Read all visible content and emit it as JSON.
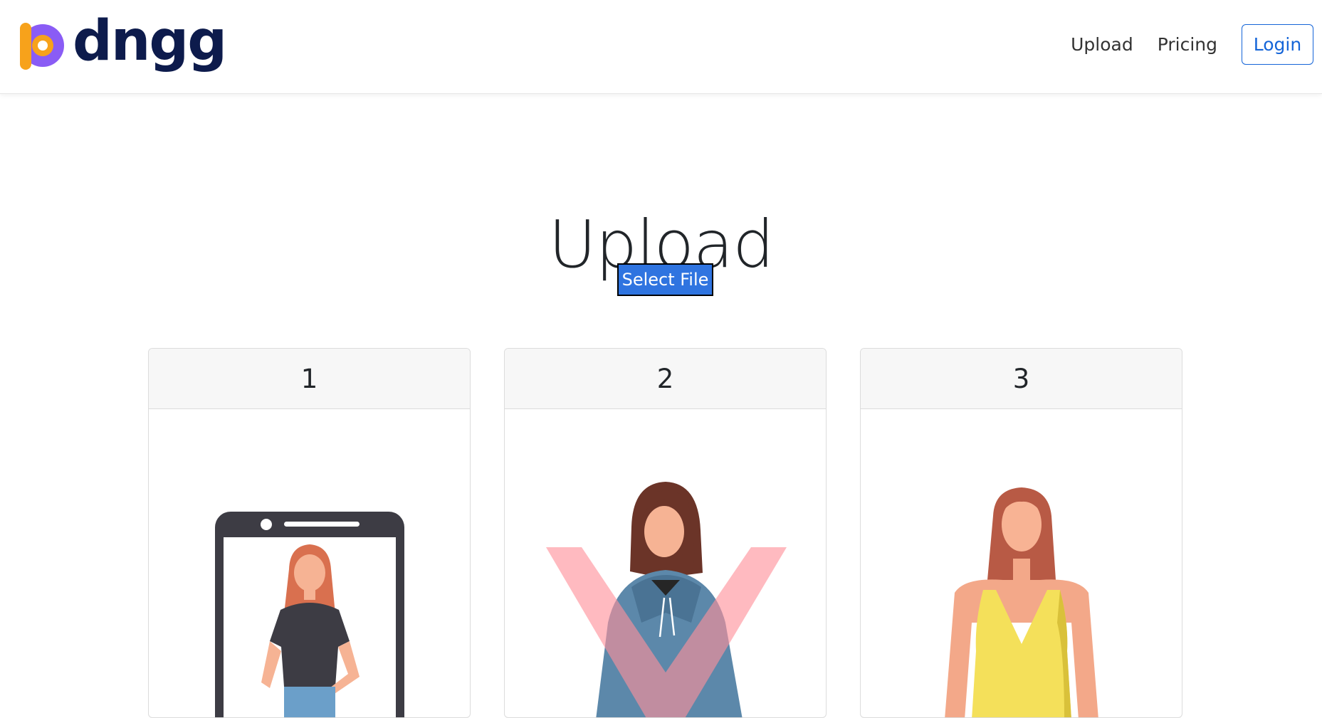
{
  "brand": {
    "name": "dngg"
  },
  "nav": {
    "upload_label": "Upload",
    "pricing_label": "Pricing",
    "login_label": "Login"
  },
  "main": {
    "title": "Upload",
    "select_file_label": "Select File",
    "steps": [
      {
        "number": "1",
        "illustration": "phone-selfie-illustration"
      },
      {
        "number": "2",
        "illustration": "hoodie-rejected-illustration"
      },
      {
        "number": "3",
        "illustration": "tank-top-illustration"
      }
    ]
  },
  "colors": {
    "primary": "#2f74e0",
    "login_border": "#1565d8",
    "brand_text": "#0d1b4c",
    "logo_orange": "#f7a21b",
    "logo_purple": "#8a5cf5",
    "reject_mark": "#ff9aa2"
  }
}
